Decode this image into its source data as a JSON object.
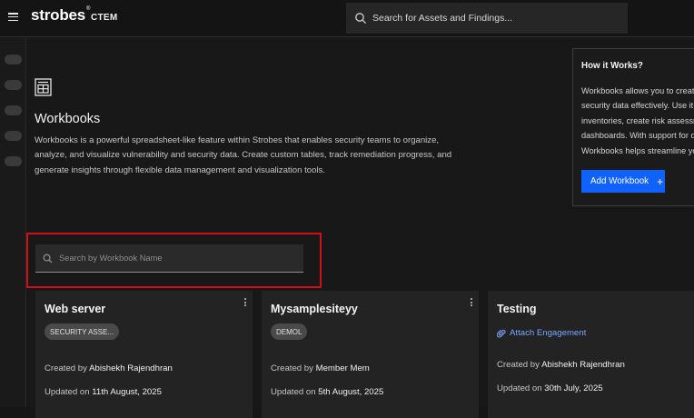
{
  "topbar": {
    "logo": "strobes",
    "logo_mark": "®",
    "app": "CTEM",
    "search_placeholder": "Search for Assets and Findings..."
  },
  "page": {
    "title": "Workbooks",
    "description": "Workbooks is a powerful spreadsheet-like feature within Strobes that enables security teams to organize, analyze, and visualize vulnerability and security data. Create custom tables, track remediation progress, and generate insights through flexible data management and visualization tools."
  },
  "how_it_works": {
    "title": "How it Works?",
    "lines": [
      "Workbooks allows you to create c",
      "security data effectively. Use it to",
      "inventories, create risk assessme",
      "dashboards. With support for dat",
      "Workbooks helps streamline you"
    ],
    "add_button": "Add Workbook",
    "add_icon": "+"
  },
  "workbook_search": {
    "placeholder": "Search by Workbook Name"
  },
  "cards": [
    {
      "title": "Web server",
      "tag": "SECURITY ASSE...",
      "created_label": "Created by",
      "created_by": "Abishekh Rajendhran",
      "updated_label": "Updated on",
      "updated_on": "11th August, 2025"
    },
    {
      "title": "Mysamplesiteyy",
      "tag": "DEMOL",
      "created_label": "Created by",
      "created_by": "Member Mem",
      "updated_label": "Updated on",
      "updated_on": "5th August, 2025"
    },
    {
      "title": "Testing",
      "engagement_link": "Attach Engagement",
      "created_label": "Created by",
      "created_by": "Abishekh Rajendhran",
      "updated_label": "Updated on",
      "updated_on": "30th July, 2025"
    }
  ],
  "colors": {
    "accent": "#0f62fe",
    "link": "#78a9ff",
    "highlight": "#d10f14",
    "background": "#161616"
  }
}
